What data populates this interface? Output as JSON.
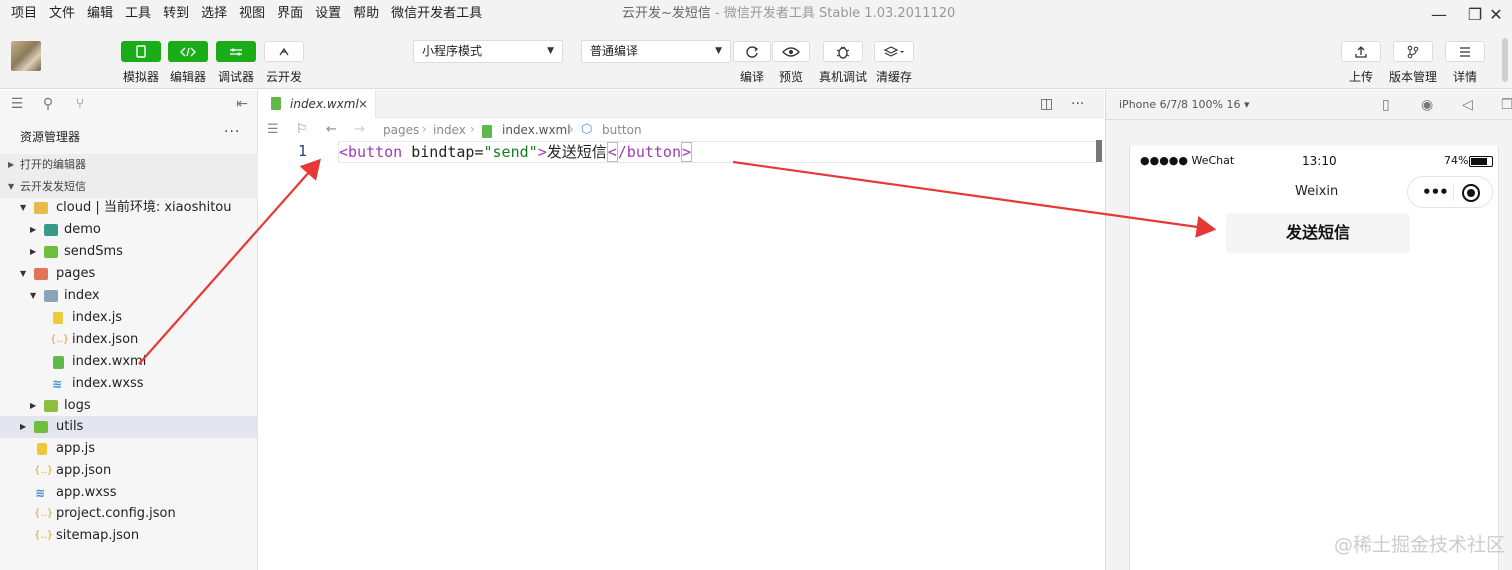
{
  "menu": [
    "项目",
    "文件",
    "编辑",
    "工具",
    "转到",
    "选择",
    "视图",
    "界面",
    "设置",
    "帮助",
    "微信开发者工具"
  ],
  "window": {
    "title": "云开发~发短信",
    "subtitle": "- 微信开发者工具 Stable 1.03.2011120",
    "minimize_icon": "—",
    "maximize_icon": "❐",
    "close_icon": "✕"
  },
  "toolbar": {
    "simulator": "模拟器",
    "editor": "编辑器",
    "debugger": "调试器",
    "cloud": "云开发",
    "mode_select": "小程序模式",
    "compile_select": "普通编译",
    "compile": "编译",
    "preview": "预览",
    "remote_debug": "真机调试",
    "clear_cache": "清缓存",
    "upload": "上传",
    "version": "版本管理",
    "details": "详情"
  },
  "sidebar": {
    "title": "资源管理器",
    "more": "···",
    "open_editors": "打开的编辑器",
    "project": "云开发发短信",
    "tree": [
      {
        "label": "cloud | 当前环境: xiaoshitou"
      },
      {
        "label": "demo"
      },
      {
        "label": "sendSms"
      },
      {
        "label": "pages"
      },
      {
        "label": "index"
      },
      {
        "label": "index.js"
      },
      {
        "label": "index.json"
      },
      {
        "label": "index.wxml"
      },
      {
        "label": "index.wxss"
      },
      {
        "label": "logs"
      },
      {
        "label": "utils"
      },
      {
        "label": "app.js"
      },
      {
        "label": "app.json"
      },
      {
        "label": "app.wxss"
      },
      {
        "label": "project.config.json"
      },
      {
        "label": "sitemap.json"
      }
    ]
  },
  "editor": {
    "tab": "index.wxml",
    "tab_close": "×",
    "breadcrumb": [
      "pages",
      "index",
      "index.wxml",
      "button"
    ],
    "line_number": "1",
    "code": {
      "open_tag": "<button",
      "attr": " bindtap=",
      "string": "\"send\"",
      "gt": ">",
      "text": "发送短信",
      "close_tag_open": "<",
      "close_tag": "/button",
      "close_gt": ">"
    }
  },
  "simulator": {
    "device": "iPhone 6/7/8 100% 16 ▾",
    "carrier": "●●●●● WeChat",
    "time": "13:10",
    "battery": "74%",
    "nav_title": "Weixin",
    "capsule_dots": "•••",
    "button_label": "发送短信"
  },
  "watermark": "@稀土掘金技术社区",
  "colors": {
    "green": "#1aad19",
    "arrow": "#e53935",
    "tag": "#a03ab8",
    "string": "#1a7a1a"
  }
}
